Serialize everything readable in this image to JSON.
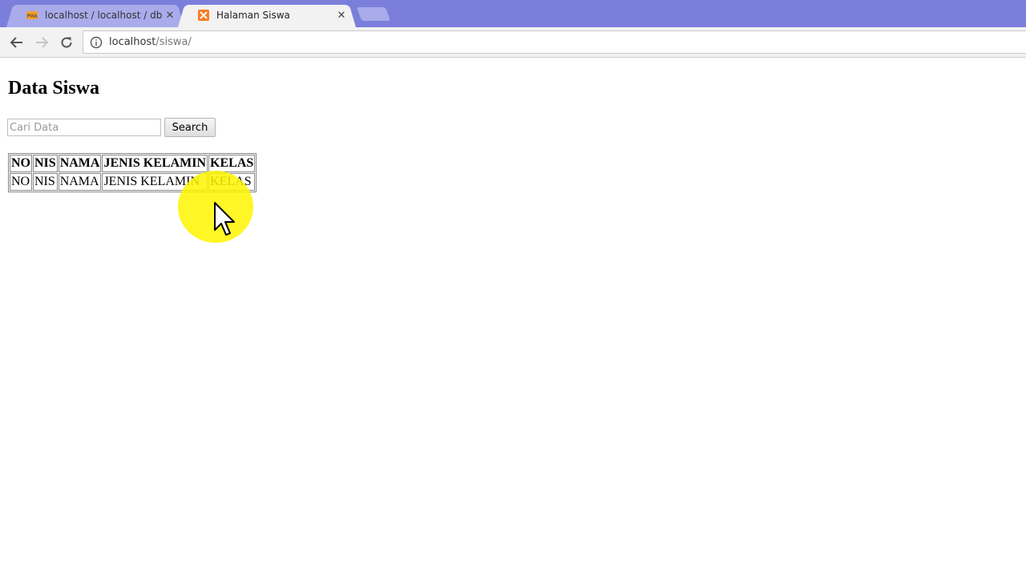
{
  "browser": {
    "tabs": [
      {
        "title": "localhost / localhost / db",
        "icon": "phpmyadmin-icon",
        "active": false
      },
      {
        "title": "Halaman Siswa",
        "icon": "xampp-icon",
        "active": true
      }
    ],
    "address": {
      "host": "localhost",
      "path": "/siswa/"
    }
  },
  "page": {
    "title": "Data Siswa",
    "search": {
      "placeholder": "Cari Data",
      "button_label": "Search"
    },
    "table": {
      "headers": [
        "NO",
        "NIS",
        "NAMA",
        "JENIS KELAMIN",
        "KELAS"
      ],
      "rows": [
        [
          "NO",
          "NIS",
          "NAMA",
          "JENIS KELAMIN",
          "KELAS"
        ]
      ]
    }
  },
  "colors": {
    "tabstrip": "#7b7fdb",
    "cursor_highlight": "#fff400"
  }
}
